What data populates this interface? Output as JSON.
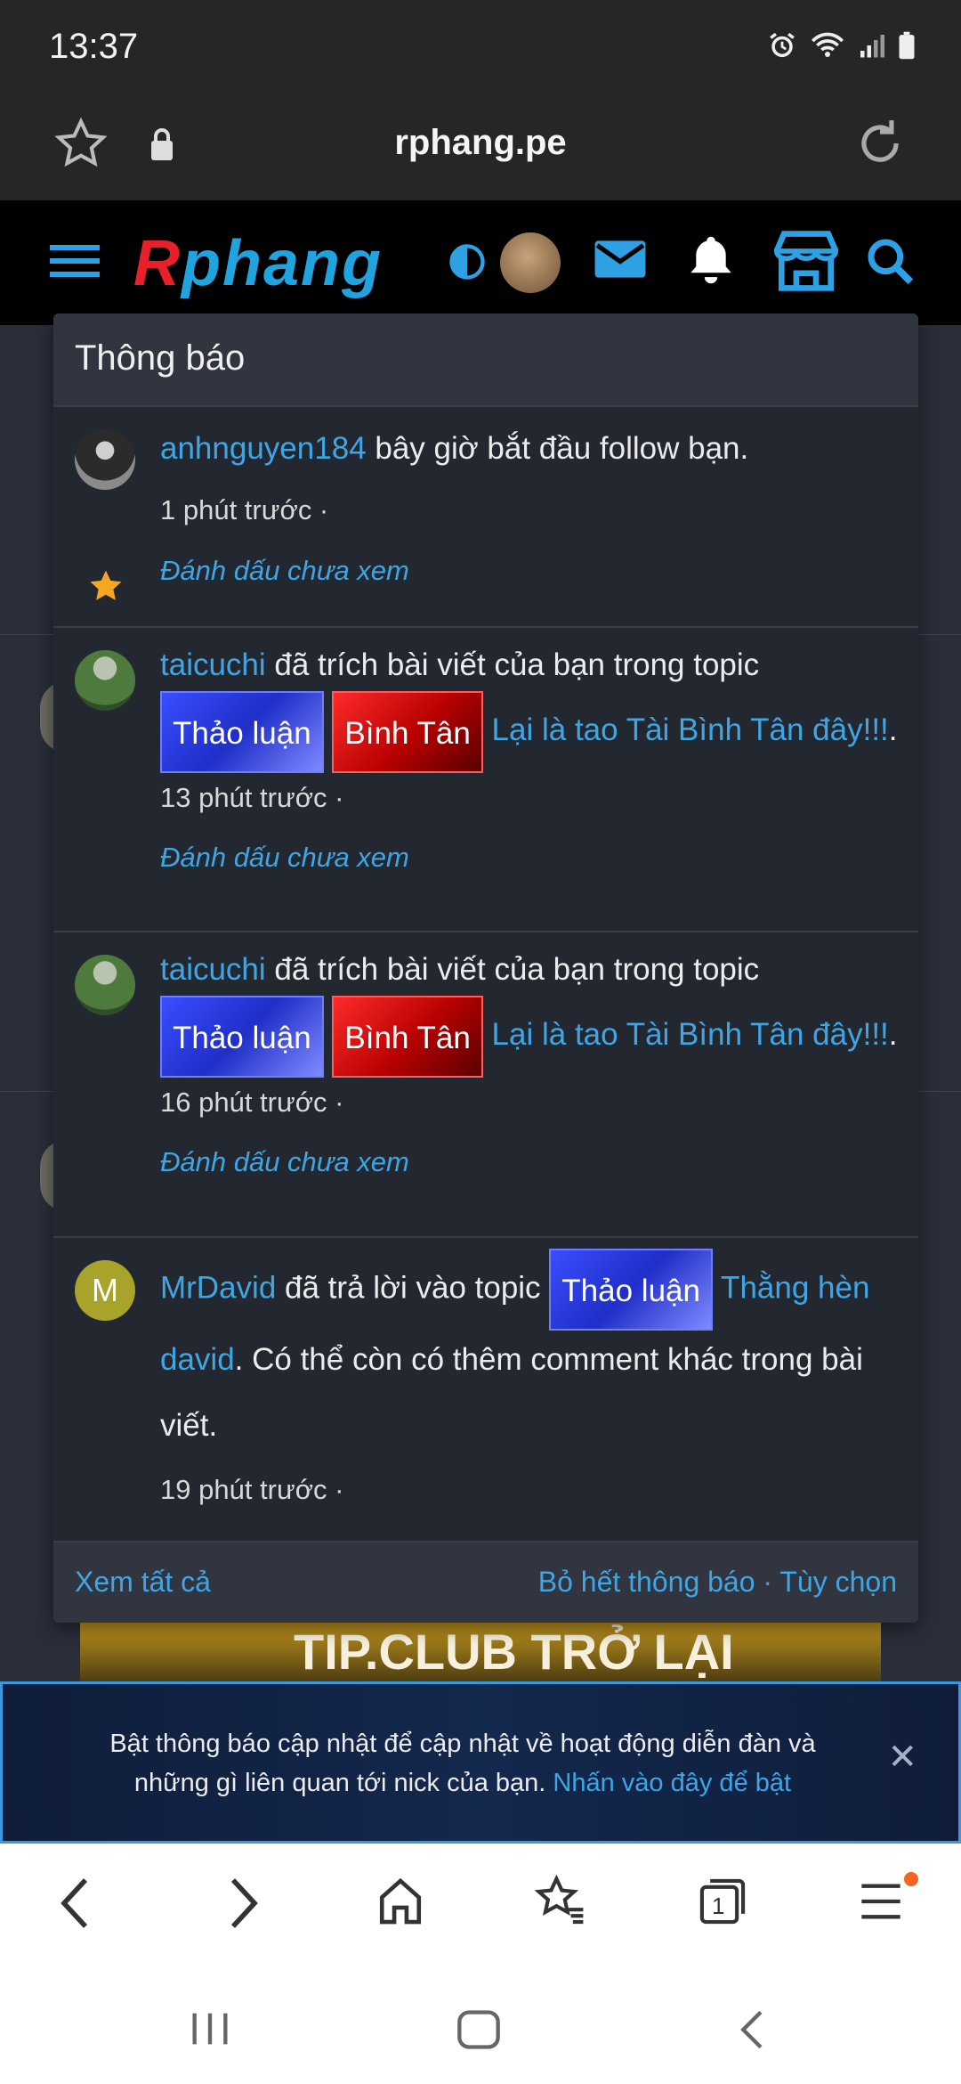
{
  "status": {
    "time": "13:37"
  },
  "browser": {
    "url": "rphang.pe"
  },
  "site": {
    "logo_part1": "R",
    "logo_part2": "phang"
  },
  "popup": {
    "title": "Thông báo",
    "notifications": [
      {
        "user": "anhnguyen184",
        "text": " bây giờ bắt đầu follow bạn.",
        "time": "1 phút trước ·",
        "mark": "Đánh dấu chưa xem"
      },
      {
        "user": "taicuchi",
        "text": " đã trích bài viết của bạn trong topic",
        "tag1": "Thảo luận",
        "tag2": "Bình Tân",
        "topic": "Lại là tao Tài Bình Tân đây!!!",
        "tail": ".",
        "time": "13 phút trước ·",
        "mark": "Đánh dấu chưa xem"
      },
      {
        "user": "taicuchi",
        "text": " đã trích bài viết của bạn trong topic",
        "tag1": "Thảo luận",
        "tag2": "Bình Tân",
        "topic": "Lại là tao Tài Bình Tân đây!!!",
        "tail": ".",
        "time": "16 phút trước ·",
        "mark": "Đánh dấu chưa xem"
      },
      {
        "avatar_letter": "M",
        "user": "MrDavid",
        "text": " đã trả lời vào topic ",
        "tag1": "Thảo luận",
        "topic_a": " Thằng hèn",
        "topic_b": "david",
        "tail": ". Có thể còn có thêm comment khác trong bài viết.",
        "time": "19 phút trước ·"
      }
    ],
    "footer": {
      "see_all": "Xem tất cả",
      "dismiss": "Bỏ hết thông báo",
      "sep": " · ",
      "options": "Tùy chọn"
    }
  },
  "banner": {
    "text": "TIP.CLUB TRỞ LẠI",
    "tip": "TIP"
  },
  "prompt": {
    "text": "Bật thông báo cập nhật để cập nhật về hoạt động diễn đàn và những gì liên quan tới nick của bạn. ",
    "link": "Nhấn vào đây để bật",
    "close": "✕"
  },
  "toolbar": {
    "tabs_count": "1"
  },
  "colors": {
    "accent": "#3fa6e6",
    "popup_bg": "#23272f",
    "header_bg": "#000000"
  }
}
